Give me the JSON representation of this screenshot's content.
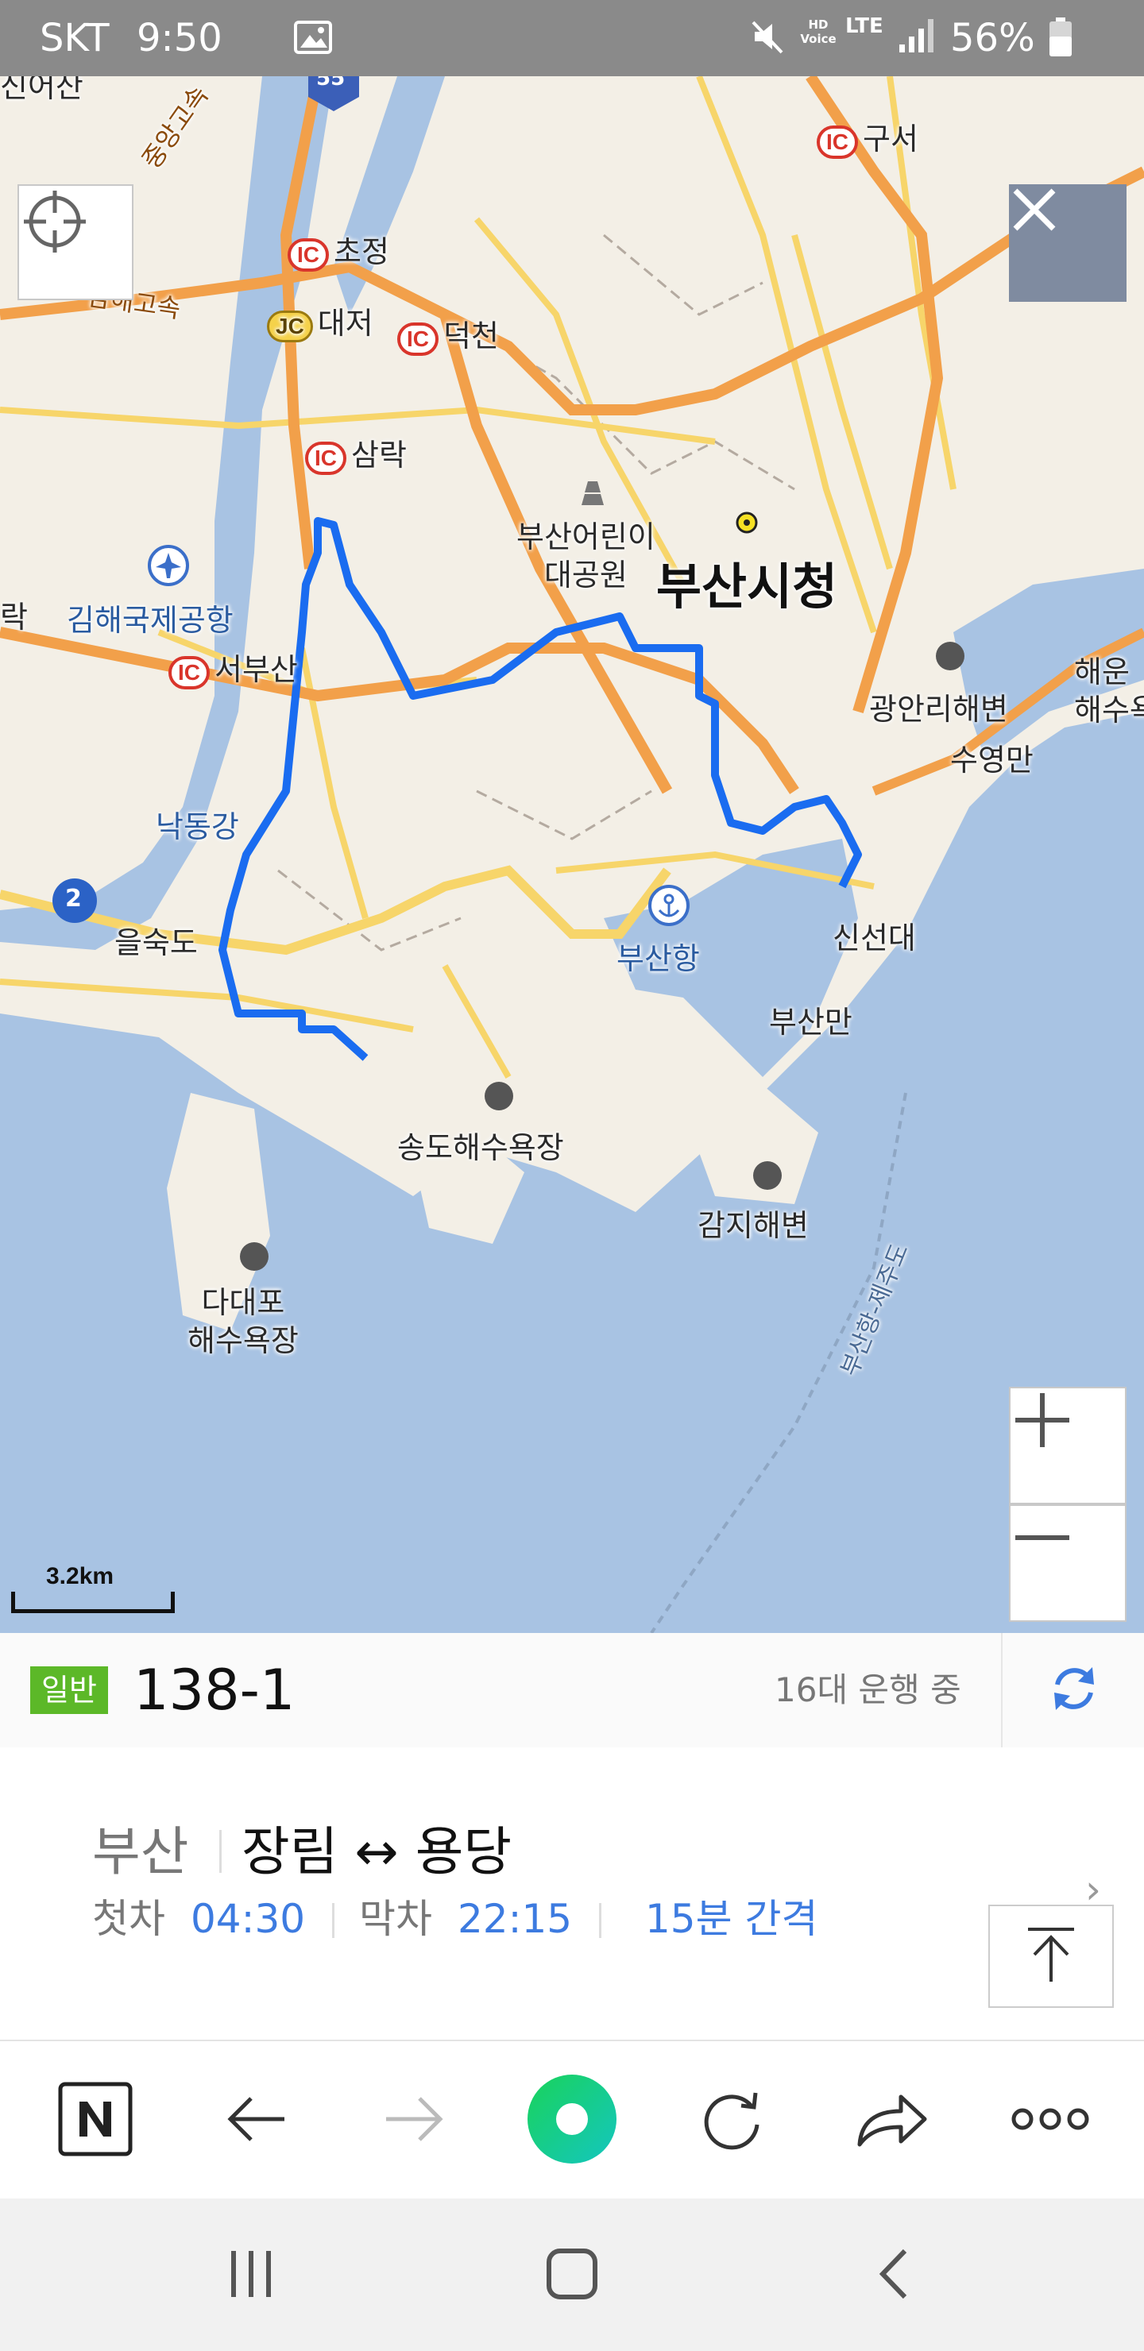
{
  "status_bar": {
    "carrier": "SKT",
    "time": "9:50",
    "hd_voice": "HD Voice",
    "network": "LTE",
    "battery": "56%"
  },
  "map": {
    "labels": {
      "highway_55": "55",
      "highway_2": "2",
      "top_left_cut": "신어산",
      "expressway_jungang": "중앙고속",
      "expressway_namhae": "남해고속",
      "ic_guseo": "구서",
      "ic_chojeong": "초정",
      "jc_daejeo": "대저",
      "ic_deokcheon": "덕천",
      "ic_samnak": "삼락",
      "ic_seobusan": "서부산",
      "airport": "김해국제공항",
      "children_park": "부산어린이\n대공원",
      "city_hall": "부산시청",
      "gwangalli": "광안리해변",
      "haeundae": "해운\n해수욕",
      "suyeongman": "수영만",
      "nakdonggang": "낙동강",
      "eulsukdo": "을숙도",
      "busan_port": "부산항",
      "sinseondae": "신선대",
      "busanman": "부산만",
      "songdo": "송도해수욕장",
      "gamji": "감지해변",
      "dadaepo": "다대포\n해수욕장",
      "ferry_route": "부산항-제주도",
      "left_cut": "락"
    },
    "scale_label": "3.2km",
    "colors": {
      "land": "#f3efe6",
      "water": "#a8c3e3",
      "expressway": "#f2a04a",
      "road": "#f7d56a",
      "route": "#1a6cf0"
    }
  },
  "route": {
    "badge": "일반",
    "number": "138-1",
    "running": "16대 운행 중",
    "region": "부산",
    "terminals": "장림 ↔ 용당",
    "first_label": "첫차",
    "first_time": "04:30",
    "last_label": "막차",
    "last_time": "22:15",
    "interval": "15분 간격"
  },
  "icons": {
    "locate": "crosshair-icon",
    "close": "close-icon",
    "zoom_in": "plus-icon",
    "zoom_out": "minus-icon",
    "refresh": "refresh-icon",
    "scroll_top": "arrow-up-to-top-icon"
  }
}
